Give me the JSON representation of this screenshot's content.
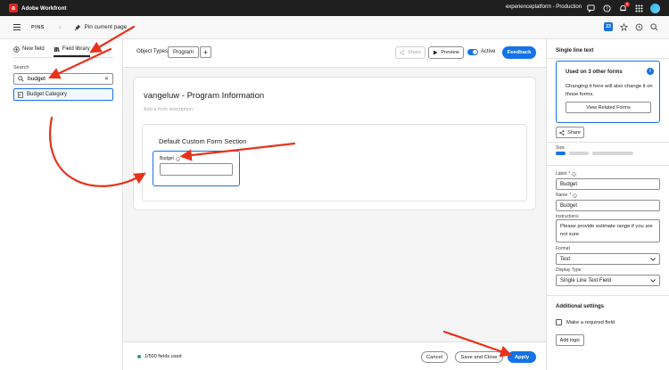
{
  "app": {
    "name": "Adobe Workfront",
    "org": "experienceplatform - Production",
    "notification_count": "6"
  },
  "subbar": {
    "pins_label": "PINS",
    "pin_current_label": "Pin current page",
    "app_badge": "23"
  },
  "left_panel": {
    "tabs": [
      {
        "label": "New field"
      },
      {
        "label": "Field library"
      }
    ],
    "search_label": "Search",
    "search_value": "budget",
    "results": [
      {
        "label": "Budget Category"
      }
    ]
  },
  "toolbar": {
    "object_types_label": "Object Types",
    "object_type_chip": "Program",
    "share_label": "Share",
    "preview_label": "Preview",
    "active_label": "Active",
    "feedback_label": "Feedback"
  },
  "form": {
    "title": "vangeluw - Program Information",
    "description_placeholder": "Add a form description",
    "section_title": "Default Custom Form Section",
    "field_label": "Budget"
  },
  "footer": {
    "fields_used": "1/500 fields used",
    "cancel_label": "Cancel",
    "save_close_label": "Save and Close",
    "apply_label": "Apply"
  },
  "properties": {
    "panel_title": "Single line text",
    "info_title": "Used on 3 other forms",
    "info_text": "Changing it here will also change it on those forms.",
    "view_related_label": "View Related Forms",
    "share_label": "Share",
    "size_label": "Size",
    "label_label": "Label",
    "label_value": "Budget",
    "name_label": "Name",
    "name_value": "Budget",
    "instructions_label": "Instructions",
    "instructions_value": "Please provide estimate range if you are not sure",
    "format_label": "Format",
    "format_value": "Text",
    "display_type_label": "Display Type",
    "display_type_value": "Single Line Text Field",
    "additional_settings_label": "Additional settings",
    "required_label": "Make a required field",
    "add_logic_label": "Add logic"
  },
  "colors": {
    "accent": "#1473e6",
    "annotation_arrow": "#e8321b",
    "brand": "#e0261c"
  }
}
